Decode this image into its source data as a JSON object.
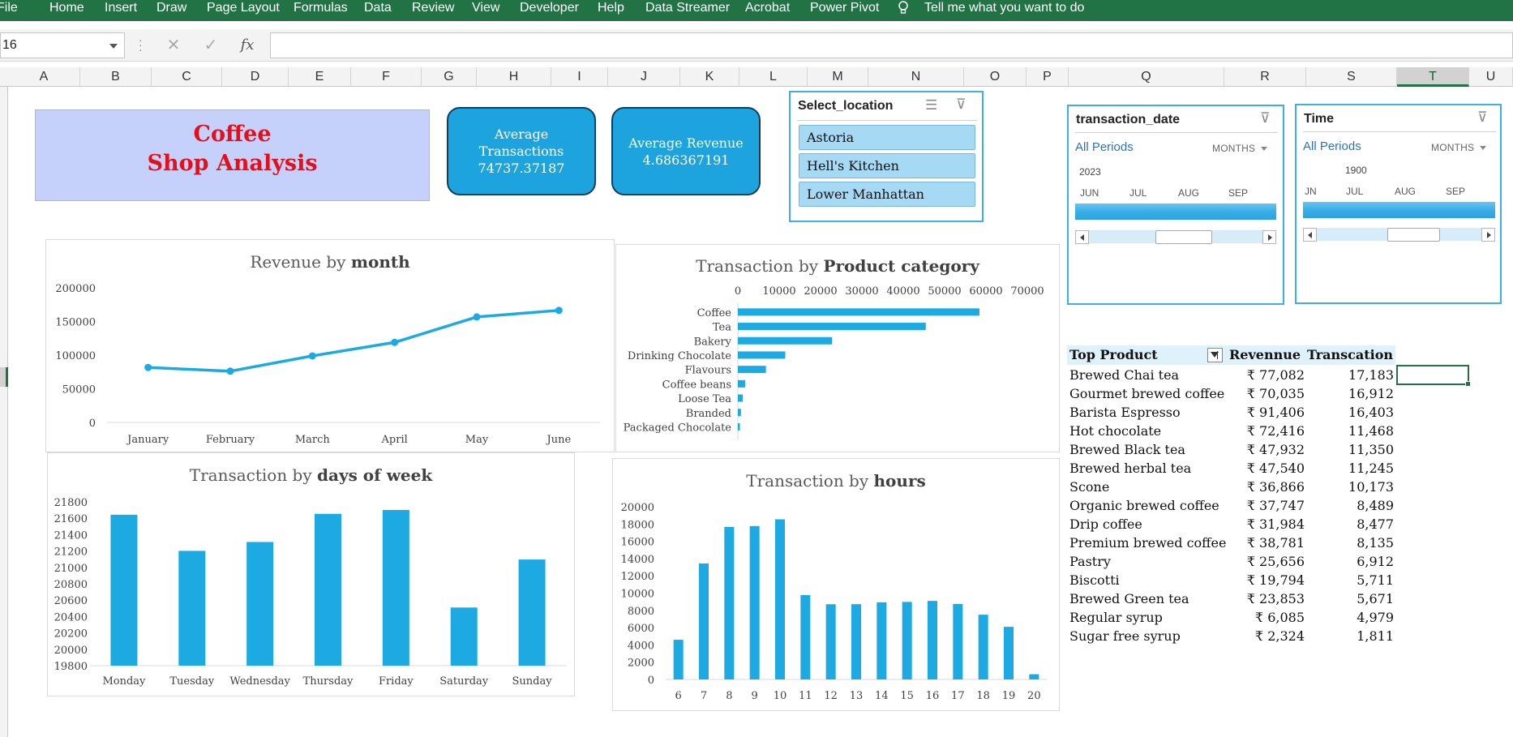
{
  "menu": {
    "tabs": [
      "File",
      "Home",
      "Insert",
      "Draw",
      "Page Layout",
      "Formulas",
      "Data",
      "Review",
      "View",
      "Developer",
      "Help",
      "Data Streamer",
      "Acrobat",
      "Power Pivot"
    ],
    "tell_me": "Tell me what you want to do"
  },
  "formula_bar": {
    "name_box": "16",
    "cancel_icon": "✕",
    "enter_icon": "✓",
    "fx_icon": "fx",
    "formula": ""
  },
  "columns": [
    "A",
    "B",
    "C",
    "D",
    "E",
    "F",
    "G",
    "H",
    "I",
    "J",
    "K",
    "L",
    "M",
    "N",
    "O",
    "P",
    "Q",
    "R",
    "S",
    "T",
    "U"
  ],
  "selected_column": "T",
  "dashboard": {
    "title_line1": "Coffee",
    "title_line2": "Shop Analysis",
    "kpi_transactions": {
      "line1": "Average",
      "line2": "Transactions",
      "value": "74737.37187"
    },
    "kpi_revenue": {
      "line1": "Average Revenue",
      "value": "4.686367191"
    }
  },
  "location_slicer": {
    "title": "Select_location",
    "items": [
      "Astoria",
      "Hell's Kitchen",
      "Lower Manhattan"
    ]
  },
  "date_timeline": {
    "title": "transaction_date",
    "all_periods": "All Periods",
    "level": "MONTHS",
    "year": "2023",
    "months": [
      "JUN",
      "JUL",
      "AUG",
      "SEP"
    ]
  },
  "time_timeline": {
    "title": "Time",
    "all_periods": "All Periods",
    "level": "MONTHS",
    "year": "1900",
    "months": [
      "JN",
      "JUL",
      "AUG",
      "SEP"
    ]
  },
  "colors": {
    "series": "#1da9e1",
    "ribbon": "#217346",
    "kpi": "#1da4df",
    "title_red": "#e3101c",
    "title_bg": "#c5d0fb"
  },
  "chart_data": [
    {
      "id": "revenue_by_month",
      "type": "line",
      "title_plain": "Revenue by ",
      "title_bold": "month",
      "categories": [
        "January",
        "February",
        "March",
        "April",
        "May",
        "June"
      ],
      "values": [
        81678,
        76145,
        98835,
        118941,
        156728,
        166486
      ],
      "yticks": [
        "0",
        "50000",
        "100000",
        "150000",
        "200000"
      ],
      "ylim": [
        0,
        200000
      ]
    },
    {
      "id": "transaction_by_product_category",
      "type": "bar",
      "orientation": "horizontal",
      "title_plain": "Transaction by ",
      "title_bold": "Product category",
      "categories": [
        "Coffee",
        "Tea",
        "Bakery",
        "Drinking Chocolate",
        "Flavours",
        "Coffee beans",
        "Loose Tea",
        "Branded",
        "Packaged Chocolate"
      ],
      "values": [
        58416,
        45449,
        22796,
        11468,
        6790,
        1753,
        1210,
        747,
        487
      ],
      "xticks": [
        "0",
        "10000",
        "20000",
        "30000",
        "40000",
        "50000",
        "60000",
        "70000"
      ],
      "xlim": [
        0,
        70000
      ]
    },
    {
      "id": "transaction_by_days_of_week",
      "type": "bar",
      "title_plain": "Transaction by ",
      "title_bold": "days of week",
      "categories": [
        "Monday",
        "Tuesday",
        "Wednesday",
        "Thursday",
        "Friday",
        "Saturday",
        "Sunday"
      ],
      "values": [
        21643,
        21202,
        21310,
        21654,
        21701,
        20510,
        21096
      ],
      "yticks": [
        "19800",
        "20000",
        "20200",
        "20400",
        "20600",
        "20800",
        "21000",
        "21200",
        "21400",
        "21600",
        "21800"
      ],
      "ylim": [
        19800,
        21800
      ]
    },
    {
      "id": "transaction_by_hours",
      "type": "bar",
      "title_plain": "Transaction by ",
      "title_bold": "hours",
      "categories": [
        "6",
        "7",
        "8",
        "9",
        "10",
        "11",
        "12",
        "13",
        "14",
        "15",
        "16",
        "17",
        "18",
        "19",
        "20"
      ],
      "values": [
        4594,
        13428,
        17654,
        17764,
        18545,
        9766,
        8708,
        8714,
        8933,
        8979,
        9093,
        8745,
        7498,
        6092,
        603
      ],
      "yticks": [
        "0",
        "2000",
        "4000",
        "6000",
        "8000",
        "10000",
        "12000",
        "14000",
        "16000",
        "18000",
        "20000"
      ],
      "ylim": [
        0,
        20000
      ]
    }
  ],
  "top_products": {
    "headers": {
      "product": "Top Product",
      "revenue": "Revennue",
      "transactions": "Transcation"
    },
    "rows": [
      {
        "product": "Brewed Chai tea",
        "revenue": "₹ 77,082",
        "transactions": "17,183"
      },
      {
        "product": "Gourmet brewed coffee",
        "revenue": "₹ 70,035",
        "transactions": "16,912"
      },
      {
        "product": "Barista Espresso",
        "revenue": "₹ 91,406",
        "transactions": "16,403"
      },
      {
        "product": "Hot chocolate",
        "revenue": "₹ 72,416",
        "transactions": "11,468"
      },
      {
        "product": "Brewed Black tea",
        "revenue": "₹ 47,932",
        "transactions": "11,350"
      },
      {
        "product": "Brewed herbal tea",
        "revenue": "₹ 47,540",
        "transactions": "11,245"
      },
      {
        "product": "Scone",
        "revenue": "₹ 36,866",
        "transactions": "10,173"
      },
      {
        "product": "Organic brewed coffee",
        "revenue": "₹ 37,747",
        "transactions": "8,489"
      },
      {
        "product": "Drip coffee",
        "revenue": "₹ 31,984",
        "transactions": "8,477"
      },
      {
        "product": "Premium brewed coffee",
        "revenue": "₹ 38,781",
        "transactions": "8,135"
      },
      {
        "product": "Pastry",
        "revenue": "₹ 25,656",
        "transactions": "6,912"
      },
      {
        "product": "Biscotti",
        "revenue": "₹ 19,794",
        "transactions": "5,711"
      },
      {
        "product": "Brewed Green tea",
        "revenue": "₹ 23,853",
        "transactions": "5,671"
      },
      {
        "product": "Regular syrup",
        "revenue": "₹ 6,085",
        "transactions": "4,979"
      },
      {
        "product": "Sugar free syrup",
        "revenue": "₹ 2,324",
        "transactions": "1,811"
      }
    ]
  }
}
